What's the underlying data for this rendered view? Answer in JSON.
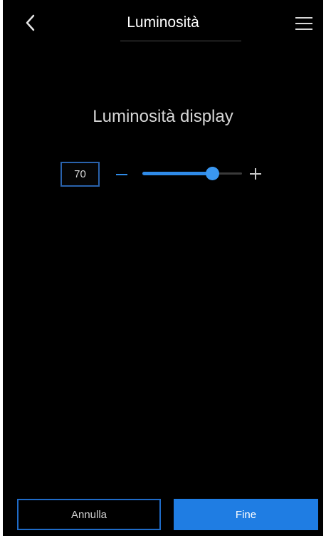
{
  "header": {
    "title": "Luminosità",
    "back_icon": "chevron-left-icon",
    "menu_icon": "hamburger-menu-icon"
  },
  "brightness": {
    "section_title": "Luminosità display",
    "value": "70",
    "min": 0,
    "max": 100,
    "level_fraction": 0.7,
    "minus_icon": "minus-icon",
    "plus_icon": "plus-icon"
  },
  "footer": {
    "cancel_label": "Annulla",
    "done_label": "Fine"
  },
  "colors": {
    "background": "#000000",
    "accent": "#1f7de3",
    "text": "#ffffff"
  }
}
